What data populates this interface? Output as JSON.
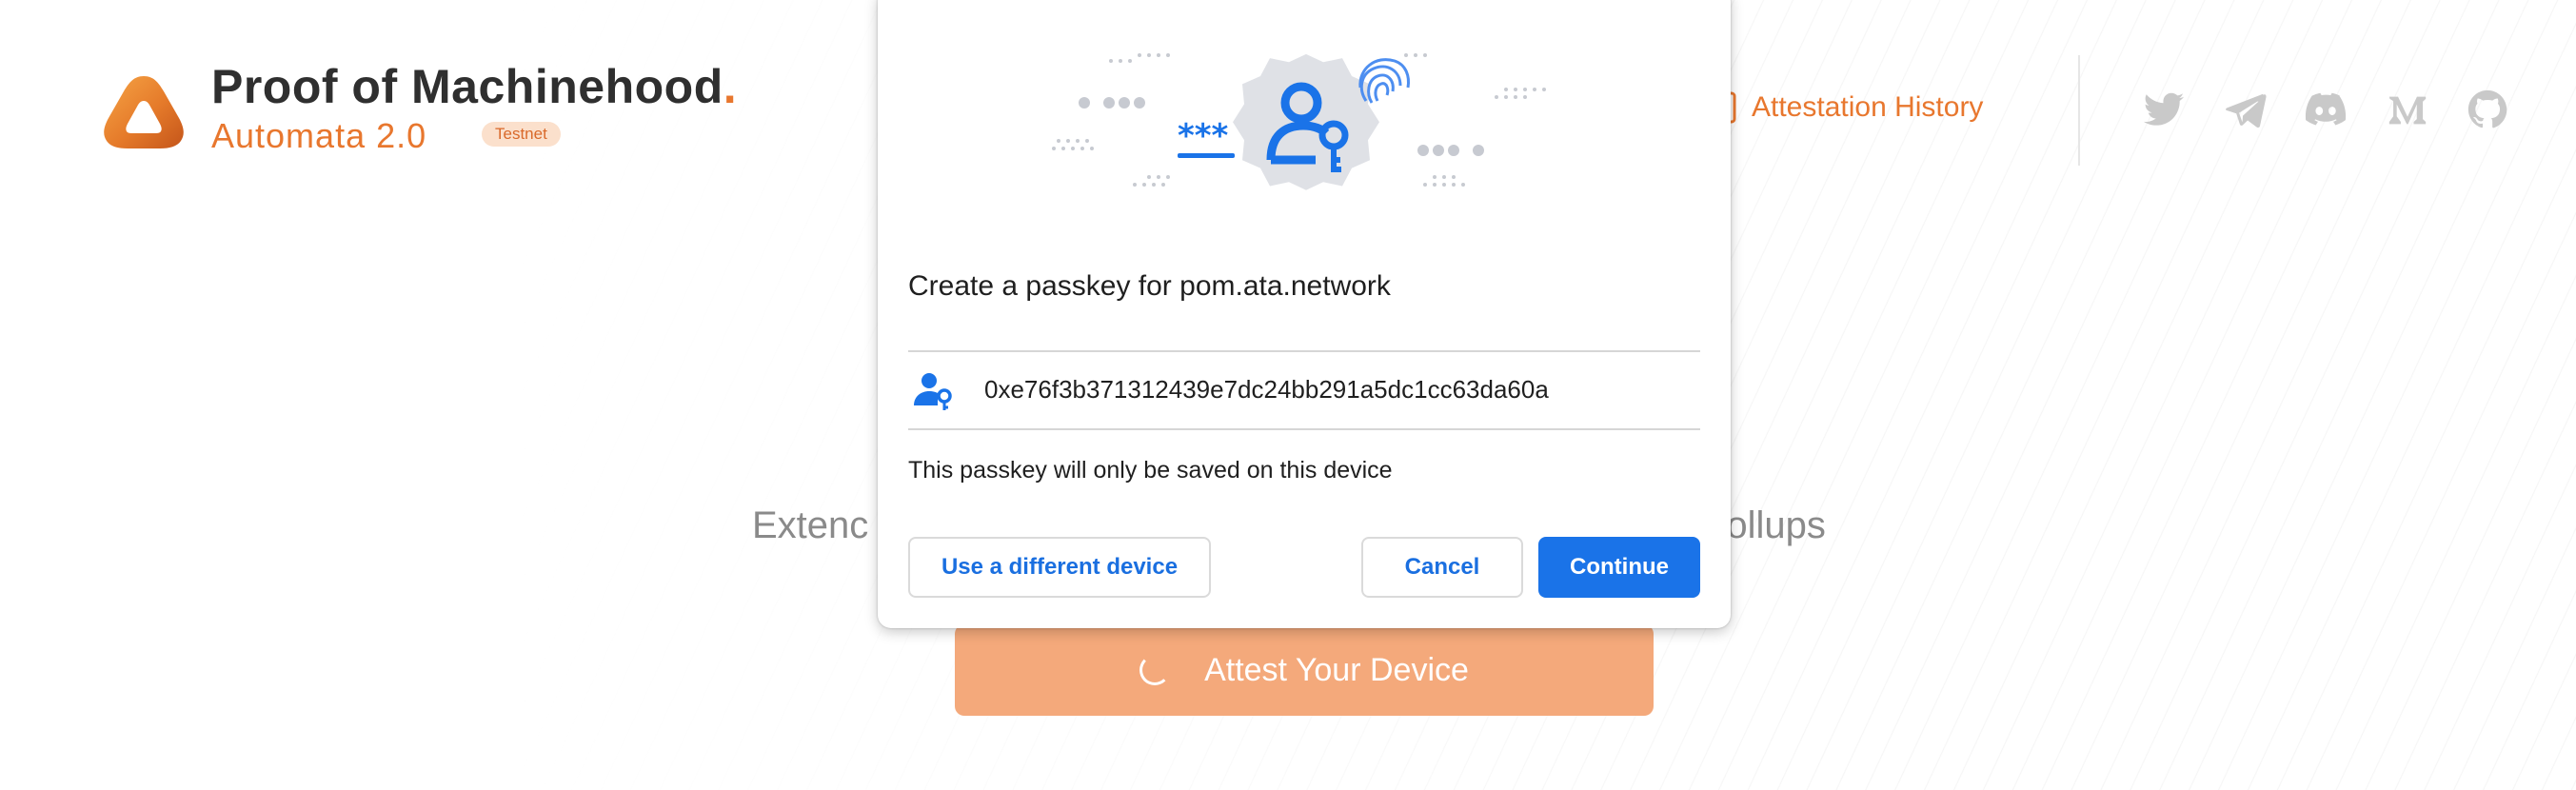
{
  "brand": {
    "title": "Proof of Machinehood",
    "title_dot": ".",
    "subtitle": "Automata 2.0",
    "badge": "Testnet",
    "accent_color": "#e8772e"
  },
  "nav": {
    "history_label": "Attestation History",
    "history_icon": "document-icon"
  },
  "social": [
    {
      "name": "twitter-icon"
    },
    {
      "name": "telegram-icon"
    },
    {
      "name": "discord-icon"
    },
    {
      "name": "medium-icon"
    },
    {
      "name": "github-icon"
    }
  ],
  "main": {
    "tagline_left": "Extenc",
    "tagline_right": "rollups",
    "attest_label": "Attest Your Device",
    "attest_color": "#f4a97b"
  },
  "dialog": {
    "title": "Create a passkey for pom.ata.network",
    "account": "0xe76f3b371312439e7dc24bb291a5dc1cc63da60a",
    "note": "This passkey will only be saved on this device",
    "buttons": {
      "other_device": "Use a different device",
      "cancel": "Cancel",
      "continue": "Continue"
    },
    "primary_color": "#1a73e8"
  }
}
